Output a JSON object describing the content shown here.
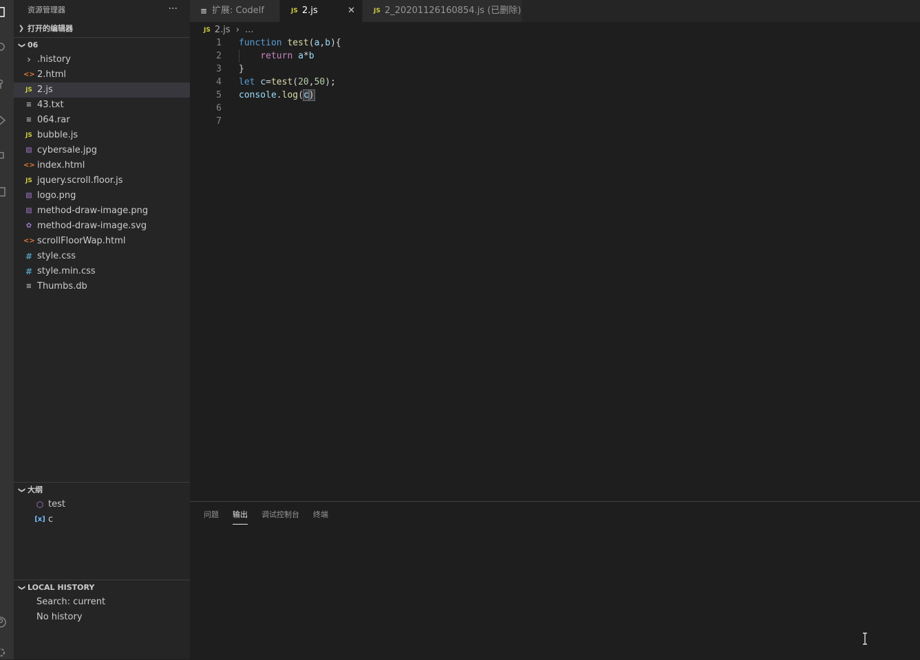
{
  "sidebar": {
    "title": "资源管理器",
    "more": "···",
    "open_editors": "打开的编辑器",
    "folder": "06",
    "files": [
      {
        "name": ".history",
        "icon": "chevron-right-icon",
        "glyph": "›"
      },
      {
        "name": "2.html",
        "icon": "html-file-icon",
        "glyph": "<>"
      },
      {
        "name": "2.js",
        "icon": "js-file-icon",
        "glyph": "JS"
      },
      {
        "name": "43.txt",
        "icon": "text-file-icon",
        "glyph": "≡"
      },
      {
        "name": "064.rar",
        "icon": "text-file-icon",
        "glyph": "≡"
      },
      {
        "name": "bubble.js",
        "icon": "js-file-icon",
        "glyph": "JS"
      },
      {
        "name": "cybersale.jpg",
        "icon": "image-file-icon",
        "glyph": "▨"
      },
      {
        "name": "index.html",
        "icon": "html-file-icon",
        "glyph": "<>"
      },
      {
        "name": "jquery.scroll.floor.js",
        "icon": "js-file-icon",
        "glyph": "JS"
      },
      {
        "name": "logo.png",
        "icon": "image-file-icon",
        "glyph": "▨"
      },
      {
        "name": "method-draw-image.png",
        "icon": "image-file-icon",
        "glyph": "▨"
      },
      {
        "name": "method-draw-image.svg",
        "icon": "svg-file-icon",
        "glyph": "✿"
      },
      {
        "name": "scrollFloorWap.html",
        "icon": "html-file-icon",
        "glyph": "<>"
      },
      {
        "name": "style.css",
        "icon": "css-file-icon",
        "glyph": "#"
      },
      {
        "name": "style.min.css",
        "icon": "css-file-icon",
        "glyph": "#"
      },
      {
        "name": "Thumbs.db",
        "icon": "text-file-icon",
        "glyph": "≡"
      }
    ],
    "outline_title": "大纲",
    "outline": [
      {
        "name": "test",
        "icon": "function-symbol-icon"
      },
      {
        "name": "c",
        "icon": "variable-symbol-icon"
      }
    ],
    "history_title": "LOCAL HISTORY",
    "history_search": "Search: current",
    "history_empty": "No history"
  },
  "tabs": [
    {
      "label": "扩展: Codelf",
      "icon": "preview-icon"
    },
    {
      "label": "2.js",
      "icon": "js-file-icon",
      "close": "✕"
    },
    {
      "label": "2_20201126160854.js (已删除)",
      "icon": "js-file-icon"
    }
  ],
  "breadcrumb": {
    "file": "2.js",
    "sep": "›",
    "rest": "..."
  },
  "editor": {
    "line_numbers": [
      "1",
      "2",
      "3",
      "4",
      "5",
      "6",
      "7"
    ]
  },
  "panel": {
    "tabs": [
      "问题",
      "输出",
      "调试控制台",
      "终端"
    ],
    "active": "输出"
  },
  "colors": {
    "js_icon": "#cbcb41",
    "html_icon": "#e37933",
    "css_icon": "#519aba",
    "image_icon": "#a074c4",
    "keyword": "#569cd6",
    "function": "#dcdcaa",
    "variable": "#9cdcfe",
    "number": "#b5cea8"
  }
}
